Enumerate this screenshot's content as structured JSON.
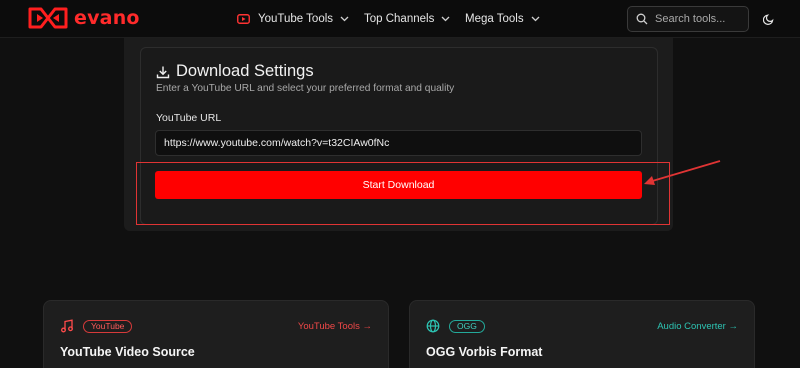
{
  "header": {
    "logo_text": "evano",
    "nav": [
      {
        "label": "YouTube Tools",
        "icon": "youtube-icon"
      },
      {
        "label": "Top Channels"
      },
      {
        "label": "Mega Tools"
      }
    ],
    "search": {
      "placeholder": "Search tools...",
      "value": ""
    },
    "theme_toggle_icon": "moon-icon"
  },
  "settings": {
    "title": "Download Settings",
    "subtitle": "Enter a YouTube URL and select your preferred format and quality",
    "url_label": "YouTube URL",
    "url_value": "https://www.youtube.com/watch?v=t32CIAw0fNc",
    "start_button": "Start Download"
  },
  "cards": [
    {
      "badge": "YouTube",
      "link": "YouTube Tools →",
      "title": "YouTube Video Source",
      "icon": "music-note-icon",
      "accent": "#ff4b4b"
    },
    {
      "badge": "OGG",
      "link": "Audio Converter →",
      "title": "OGG Vorbis Format",
      "icon": "globe-icon",
      "accent": "#2dc4b3"
    }
  ],
  "colors": {
    "brand_red": "#ff0000",
    "teal": "#2dc4b3",
    "background": "#101010",
    "annotation_red": "#e03434"
  }
}
